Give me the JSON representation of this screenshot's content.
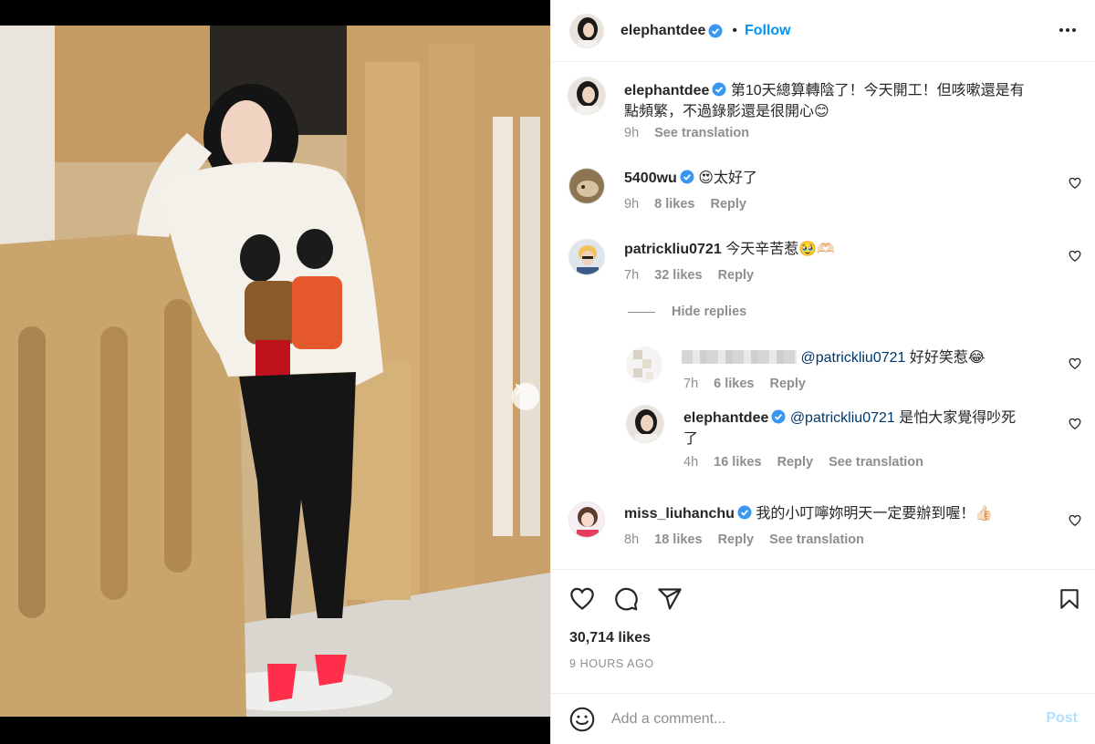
{
  "post": {
    "username": "elephantdee",
    "follow_label": "Follow",
    "dot": "•",
    "caption_line1": "第10天總算轉陰了！今天開工！但咳嗽還是有",
    "caption_line2": "點頻繁，不過錄影還是很開心😊",
    "caption_time": "9h",
    "caption_translate": "See translation"
  },
  "comments": [
    {
      "username": "5400wu",
      "text": "😍太好了",
      "time": "9h",
      "likes": "8 likes",
      "reply": "Reply"
    },
    {
      "username": "patrickliu0721",
      "text": "今天辛苦惹🥹🫶🏻",
      "time": "7h",
      "likes": "32 likes",
      "reply": "Reply"
    },
    {
      "username": "miss_liuhanchu",
      "text": "我的小叮嚀妳明天一定要辦到喔！👍🏻",
      "time": "8h",
      "likes": "18 likes",
      "reply": "Reply",
      "translate": "See translation"
    }
  ],
  "hide_replies": "Hide replies",
  "replies": [
    {
      "mention": "@patrickliu0721",
      "text": "好好笑惹😂",
      "time": "7h",
      "likes": "6 likes",
      "reply": "Reply"
    },
    {
      "username": "elephantdee",
      "mention": "@patrickliu0721",
      "text_line1": "是怕大家覺得吵死",
      "text_line2": "了",
      "time": "4h",
      "likes": "16 likes",
      "reply": "Reply",
      "translate": "See translation"
    }
  ],
  "footer": {
    "likes": "30,714 likes",
    "time_ago": "9 HOURS AGO",
    "comment_placeholder": "Add a comment...",
    "post_label": "Post"
  },
  "carousel": {
    "slides": 2,
    "active_slide": 1
  },
  "colors": {
    "accent": "#0095f6",
    "verified": "#3897f0",
    "text": "#262626",
    "muted": "#8e8e8e",
    "post_disabled": "#b2dffc"
  },
  "icons": [
    "verified-badge-icon",
    "more-options-icon",
    "heart-icon",
    "comment-icon",
    "share-icon",
    "bookmark-icon",
    "emoji-icon",
    "chevron-right-icon"
  ]
}
